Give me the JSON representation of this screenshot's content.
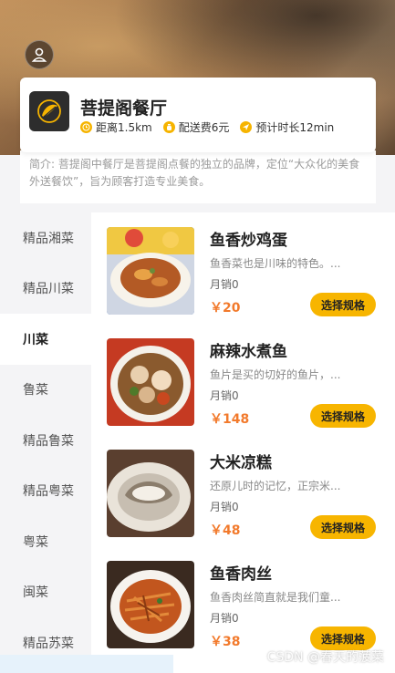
{
  "shop": {
    "name": "菩提阁餐厅",
    "distance": "距离1.5km",
    "delivery_fee": "配送费6元",
    "eta": "预计时长12min",
    "intro": "简介: 菩提阁中餐厅是菩提阁点餐的独立的品牌，定位“大众化的美食外送餐饮”，旨为顾客打造专业美食。"
  },
  "categories": [
    "精品湘菜",
    "精品川菜",
    "川菜",
    "鲁菜",
    "精品鲁菜",
    "精品粤菜",
    "粤菜",
    "闽菜",
    "精品苏菜"
  ],
  "active_category": "川菜",
  "dishes": [
    {
      "name": "鱼香炒鸡蛋",
      "desc": "鱼香菜也是川味的特色。...",
      "sales": "月销0",
      "price": "￥20",
      "button": "选择规格"
    },
    {
      "name": "麻辣水煮鱼",
      "desc": "鱼片是买的切好的鱼片，...",
      "sales": "月销0",
      "price": "￥148",
      "button": "选择规格"
    },
    {
      "name": "大米凉糕",
      "desc": "还原儿时的记忆，正宗米...",
      "sales": "月销0",
      "price": "￥48",
      "button": "选择规格"
    },
    {
      "name": "鱼香肉丝",
      "desc": "鱼香肉丝简直就是我们童...",
      "sales": "月销0",
      "price": "￥38",
      "button": "选择规格"
    }
  ],
  "watermark": "CSDN @春天的菠菜",
  "colors": {
    "accent": "#f7b500",
    "price": "#f27a2c"
  }
}
